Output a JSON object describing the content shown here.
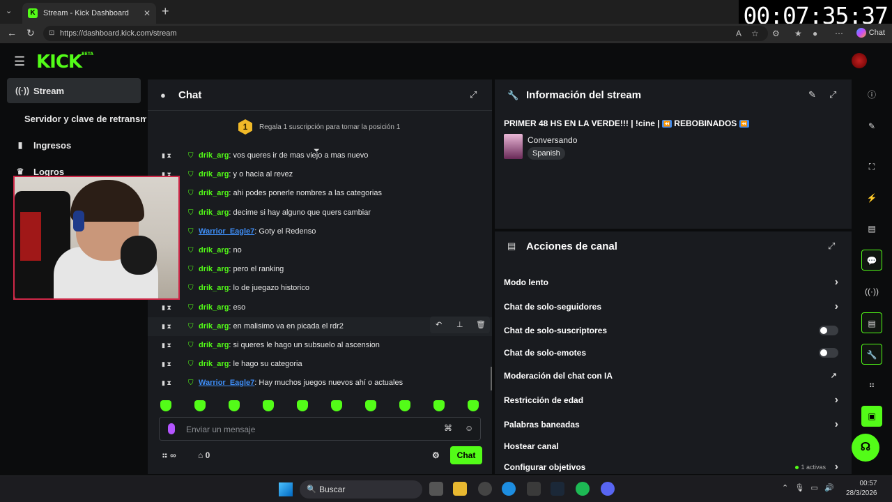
{
  "browser": {
    "tab_title": "Stream - Kick Dashboard",
    "url": "https://dashboard.kick.com/stream",
    "chat_button": "Chat"
  },
  "timer": "00:07:35:37",
  "app": {
    "logo": "KICK",
    "logo_badge": "BETA"
  },
  "sidebar": {
    "items": [
      {
        "label": "Stream",
        "icon": "broadcast-icon"
      },
      {
        "label": "Servidor y clave de retransm",
        "icon": ""
      },
      {
        "label": "Ingresos",
        "icon": "bar-chart-icon"
      },
      {
        "label": "Logros",
        "icon": "trophy-icon"
      }
    ]
  },
  "chat": {
    "title": "Chat",
    "leaderboard_text": "Regala 1 suscripción para tomar la posición 1",
    "leaderboard_rank": "1",
    "messages": [
      {
        "user": "drik_arg",
        "text": ": vos queres ir de mas viejo a mas nuevo"
      },
      {
        "user": "drik_arg",
        "text": ": y o hacia al revez"
      },
      {
        "user": "drik_arg",
        "text": ": ahi podes ponerle nombres a las categorias"
      },
      {
        "user": "drik_arg",
        "text": ": decime si hay alguno que quers cambiar"
      },
      {
        "user": "Warrior_Eagle7",
        "text": ": Goty el Redenso"
      },
      {
        "user": "drik_arg",
        "text": ": no"
      },
      {
        "user": "drik_arg",
        "text": ": pero el ranking"
      },
      {
        "user": "drik_arg",
        "text": ": lo de juegazo historico"
      },
      {
        "user": "drik_arg",
        "text": ": eso"
      },
      {
        "user": "drik_arg",
        "text": ": en malisimo va en picada el rdr2"
      },
      {
        "user": "drik_arg",
        "text": ": si queres le hago un subsuelo al ascension"
      },
      {
        "user": "drik_arg",
        "text": ": le hago su categoria"
      },
      {
        "user": "Warrior_Eagle7",
        "text": ": Hay muchos juegos nuevos ahí o actuales"
      }
    ],
    "input_placeholder": "Enviar un mensaje",
    "send_label": "Chat",
    "viewers_value": "∞",
    "shop_count": "0"
  },
  "stream_info": {
    "title": "Información del stream",
    "stream_title": "PRIMER 48 HS EN LA VERDE!!! | !cine |",
    "stream_title_tag": "REBOBINADOS",
    "category": "Conversando",
    "language": "Spanish"
  },
  "actions": {
    "title": "Acciones de canal",
    "items": [
      {
        "label": "Modo lento",
        "control": "chevron"
      },
      {
        "label": "Chat de solo-seguidores",
        "control": "chevron"
      },
      {
        "label": "Chat de solo-suscriptores",
        "control": "toggle",
        "enabled": false
      },
      {
        "label": "Chat de solo-emotes",
        "control": "toggle",
        "enabled": false
      },
      {
        "label": "Moderación del chat con IA",
        "control": "chart"
      },
      {
        "label": "Restricción de edad",
        "control": "chevron"
      },
      {
        "label": "Palabras baneadas",
        "control": "chevron"
      },
      {
        "label": "Hostear canal",
        "control": "none"
      },
      {
        "label": "Configurar objetivos",
        "control": "chevron",
        "status": "1 activas"
      }
    ]
  },
  "taskbar": {
    "search_placeholder": "Buscar",
    "time": "00:57",
    "date": "28/3/2026"
  },
  "colors": {
    "accent": "#53fc18",
    "link_user": "#3e8ef7",
    "panel_bg": "#191b1f"
  }
}
